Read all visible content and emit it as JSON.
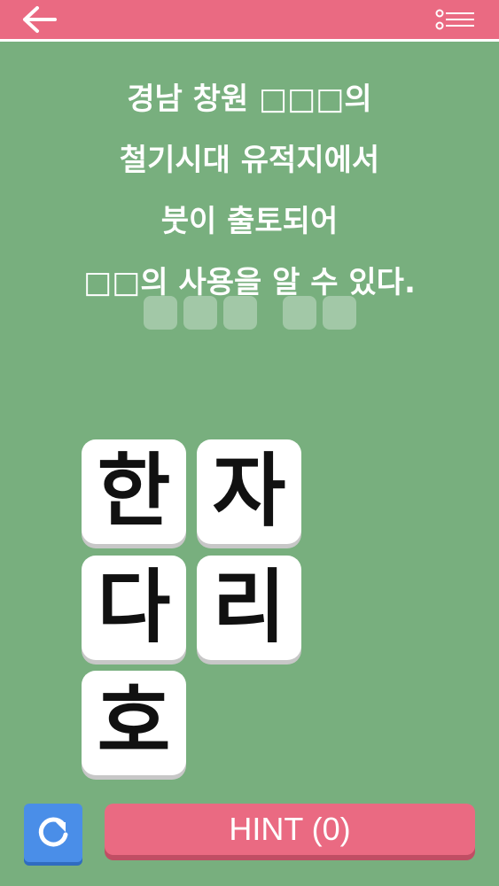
{
  "header": {
    "back_icon": "arrow-left-icon",
    "menu_icon": "list-menu-icon",
    "color": "#ea6a82"
  },
  "question": {
    "lines": [
      "경남 창원 □□□의",
      "철기시대 유적지에서",
      "붓이 출토되어",
      "□□의 사용을 알 수 있다."
    ]
  },
  "answer_slots": {
    "groups": [
      3,
      2
    ]
  },
  "tiles": [
    {
      "char": "한"
    },
    {
      "char": "자"
    },
    {
      "char": "다"
    },
    {
      "char": "리"
    },
    {
      "char": "호"
    }
  ],
  "bottom": {
    "refresh_icon": "refresh-icon",
    "hint_label": "HINT (0)",
    "refresh_color": "#4a8ee8",
    "hint_color": "#ea6a82"
  },
  "colors": {
    "background": "#78af7e",
    "tile": "#ffffff",
    "slot": "#a2c8a7"
  }
}
